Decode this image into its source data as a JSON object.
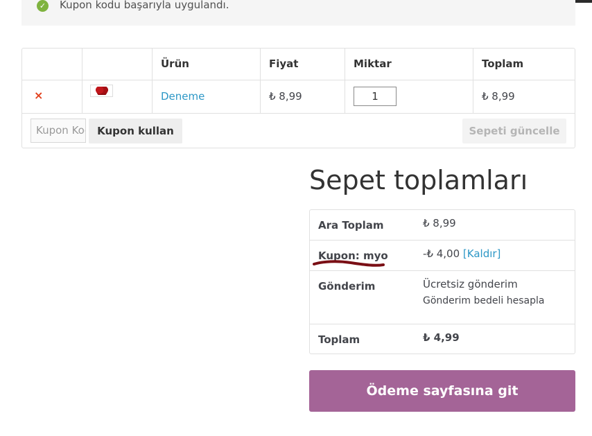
{
  "notice": {
    "text": "Kupon kodu başarıyla uygulandı."
  },
  "cart": {
    "headers": {
      "product": "Ürün",
      "price": "Fiyat",
      "quantity": "Miktar",
      "total": "Toplam"
    },
    "rows": [
      {
        "remove": "×",
        "name": "Deneme",
        "price": "₺ 8,99",
        "quantity": "1",
        "subtotal": "₺ 8,99"
      }
    ],
    "coupon_placeholder": "Kupon Kodu",
    "apply_coupon_label": "Kupon kullan",
    "update_cart_label": "Sepeti güncelle"
  },
  "totals": {
    "title": "Sepet toplamları",
    "subtotal_label": "Ara Toplam",
    "subtotal_value": "₺ 8,99",
    "coupon_label": "Kupon: myo",
    "coupon_value": "-₺ 4,00",
    "coupon_remove_label": "[Kaldır]",
    "shipping_label": "Gönderim",
    "shipping_value": "Ücretsiz gönderim",
    "shipping_calc_link": "Gönderim bedeli hesapla",
    "total_label": "Toplam",
    "total_value": "₺ 4,99"
  },
  "checkout_label": "Ödeme sayfasına git",
  "colors": {
    "accent": "#a46497",
    "link": "#2c97c6",
    "remove": "#e2401c",
    "success": "#7fb33f",
    "annotation": "#7a0f15"
  }
}
